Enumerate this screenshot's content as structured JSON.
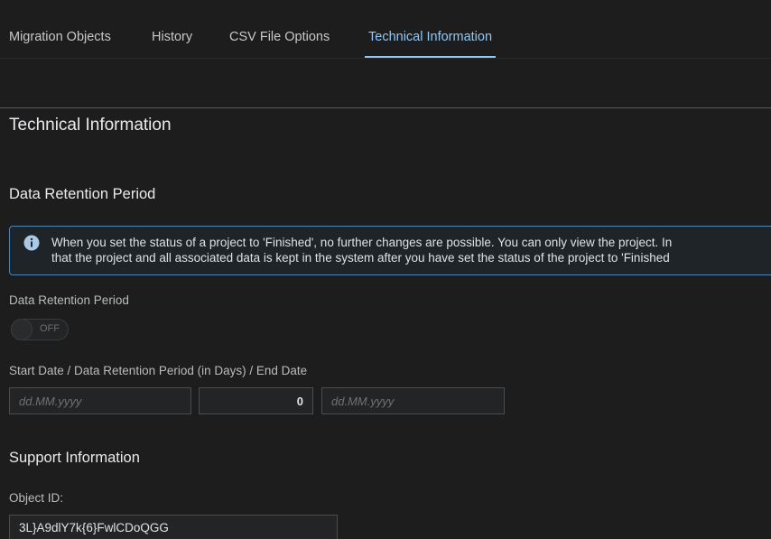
{
  "tabs": [
    {
      "label": "Migration Objects"
    },
    {
      "label": "History"
    },
    {
      "label": "CSV File Options"
    },
    {
      "label": "Technical Information"
    }
  ],
  "active_tab": "Technical Information",
  "page_title": "Technical Information",
  "data_retention": {
    "section_title": "Data Retention Period",
    "info_line1": "When you set the status of a project to 'Finished', no further changes are possible. You can only view the project. In",
    "info_line2": "that the project and all associated data is kept in the system after you have set the status of the project to 'Finished",
    "toggle_label": "Data Retention Period",
    "toggle_state": "OFF",
    "dates_label": "Start Date / Data Retention Period (in Days) / End Date",
    "start_placeholder": "dd.MM.yyyy",
    "days_value": "0",
    "end_placeholder": "dd.MM.yyyy"
  },
  "support": {
    "section_title": "Support Information",
    "object_id_label": "Object ID:",
    "object_id_value": "3L}A9dlY7k{6}FwlCDoQGG"
  },
  "colors": {
    "accent": "#91c8f6",
    "background": "#1d1d1e",
    "info_border": "#4a86b8"
  },
  "icons": {
    "info": "info-icon"
  }
}
